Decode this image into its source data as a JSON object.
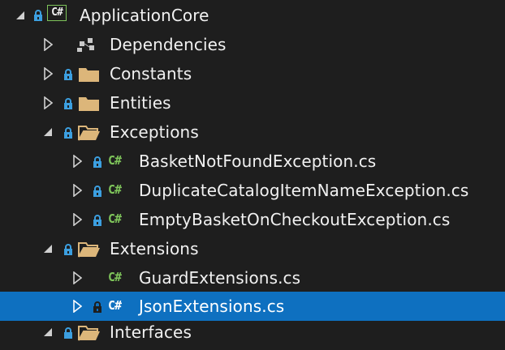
{
  "tree": {
    "project": {
      "name": "ApplicationCore",
      "icon": "csharp-project-icon",
      "lock_icon": "lock-icon",
      "expanded": true
    },
    "items": [
      {
        "label": "Dependencies",
        "icon": "dependencies-icon",
        "expanded": false
      },
      {
        "label": "Constants",
        "icon": "folder-icon",
        "expanded": false
      },
      {
        "label": "Entities",
        "icon": "folder-icon",
        "expanded": false
      },
      {
        "label": "Exceptions",
        "icon": "folder-open-icon",
        "expanded": true
      },
      {
        "label": "BasketNotFoundException.cs",
        "icon": "csharp-file-icon",
        "expanded": false
      },
      {
        "label": "DuplicateCatalogItemNameException.cs",
        "icon": "csharp-file-icon",
        "expanded": false
      },
      {
        "label": "EmptyBasketOnCheckoutException.cs",
        "icon": "csharp-file-icon",
        "expanded": false
      },
      {
        "label": "Extensions",
        "icon": "folder-open-icon",
        "expanded": true
      },
      {
        "label": "GuardExtensions.cs",
        "icon": "csharp-file-icon",
        "expanded": false
      },
      {
        "label": "JsonExtensions.cs",
        "icon": "csharp-file-icon",
        "expanded": false,
        "selected": true
      },
      {
        "label": "Interfaces",
        "icon": "folder-open-icon",
        "expanded": true
      }
    ]
  },
  "colors": {
    "background": "#1e1e1e",
    "selection": "#0e70c0",
    "folder": "#dcb67a",
    "csharp": "#7ec45a",
    "lock": "#3c9fe0",
    "text": "#f1f1f1"
  },
  "icons": {
    "csharp_glyph": "C#"
  }
}
